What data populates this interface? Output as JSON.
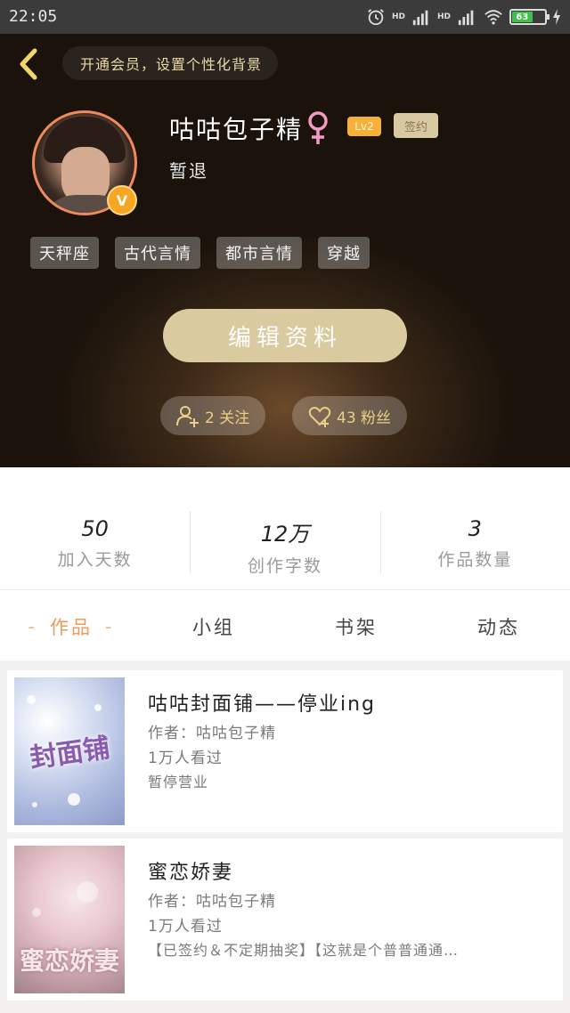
{
  "status_bar": {
    "time": "22:05",
    "hd1": "HD",
    "hd2": "HD",
    "battery": "63"
  },
  "header": {
    "vip_banner": "开通会员，设置个性化背景",
    "username": "咕咕包子精",
    "level": "Lv2",
    "sign_badge": "签约",
    "bio": "暂退",
    "vip_badge": "V",
    "tags": [
      "天秤座",
      "古代言情",
      "都市言情",
      "穿越"
    ],
    "edit_button": "编辑资料",
    "follow": "2 关注",
    "fans": "43 粉丝"
  },
  "stats": [
    {
      "value": "50",
      "label": "加入天数"
    },
    {
      "value": "12万",
      "label": "创作字数"
    },
    {
      "value": "3",
      "label": "作品数量"
    }
  ],
  "tabs": {
    "works": "作品",
    "group": "小组",
    "shelf": "书架",
    "activity": "动态",
    "active_dash": "-"
  },
  "works": [
    {
      "title": "咕咕封面铺——停业ing",
      "author": "作者：咕咕包子精",
      "views": "1万人看过",
      "desc": "暂停营业",
      "cover_text": "封面铺"
    },
    {
      "title": "蜜恋娇妻",
      "author": "作者：咕咕包子精",
      "views": "1万人看过",
      "desc": "【已签约＆不定期抽奖】【这就是个普普通通…",
      "cover_text": "蜜恋娇妻"
    }
  ],
  "colors": {
    "accent": "#f09a5a",
    "gold": "#e9cf87",
    "edit_button": "#d9ca9f",
    "level_badge": "#f5b13a"
  },
  "icons": [
    "back-arrow-icon",
    "alarm-icon",
    "signal-icon",
    "wifi-icon",
    "battery-icon",
    "female-icon",
    "add-user-icon",
    "heart-icon"
  ]
}
